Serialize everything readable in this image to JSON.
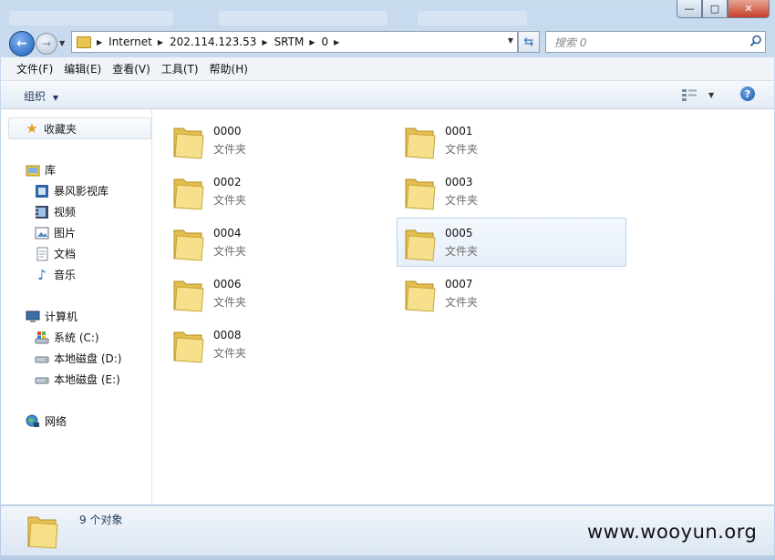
{
  "window": {
    "minimize_glyph": "—",
    "maximize_glyph": "□",
    "close_glyph": "✕"
  },
  "nav": {
    "back_glyph": "←",
    "forward_glyph": "→",
    "breadcrumb": [
      "Internet",
      "202.114.123.53",
      "SRTM",
      "0"
    ],
    "search_placeholder": "搜索 0"
  },
  "menu": [
    "文件(F)",
    "编辑(E)",
    "查看(V)",
    "工具(T)",
    "帮助(H)"
  ],
  "command_bar": {
    "organize_label": "组织",
    "help_glyph": "?"
  },
  "sidebar": {
    "favorites": "收藏夹",
    "libraries": "库",
    "library_items": [
      "暴风影视库",
      "视频",
      "图片",
      "文档",
      "音乐"
    ],
    "computer": "计算机",
    "drives": [
      "系统 (C:)",
      "本地磁盘 (D:)",
      "本地磁盘 (E:)"
    ],
    "network": "网络"
  },
  "folders": [
    {
      "name": "0000",
      "type": "文件夹"
    },
    {
      "name": "0001",
      "type": "文件夹"
    },
    {
      "name": "0002",
      "type": "文件夹"
    },
    {
      "name": "0003",
      "type": "文件夹"
    },
    {
      "name": "0004",
      "type": "文件夹"
    },
    {
      "name": "0005",
      "type": "文件夹",
      "selected": true
    },
    {
      "name": "0006",
      "type": "文件夹"
    },
    {
      "name": "0007",
      "type": "文件夹"
    },
    {
      "name": "0008",
      "type": "文件夹"
    }
  ],
  "status": {
    "count_text": "9 个对象"
  },
  "watermark": "www.wooyun.org",
  "colors": {
    "folder_yellow": "#f2d675",
    "selection_border": "#b8d4ee",
    "link_blue": "#1e395b"
  }
}
